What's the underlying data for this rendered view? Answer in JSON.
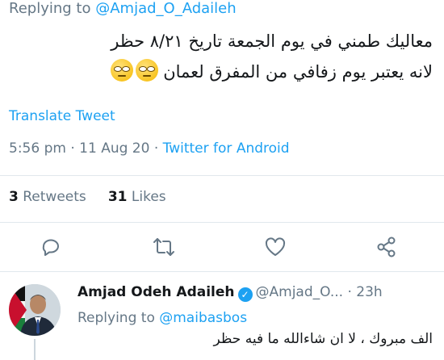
{
  "reply_to": {
    "prefix": "Replying to",
    "handle": "@Amjad_O_Adaileh"
  },
  "tweet": {
    "line1": "معاليك طمني في يوم الجمعة تاريخ ٨/٢١ حظر",
    "line2": "لانه يعتبر يوم زفافي من المفرق لعمان",
    "emojis": [
      "face-with-rolling-eyes-emoji",
      "face-with-rolling-eyes-emoji"
    ]
  },
  "translate_label": "Translate Tweet",
  "meta": {
    "time": "5:56 pm",
    "sep1": " · ",
    "date": "11 Aug 20",
    "sep2": " · ",
    "source": "Twitter for Android"
  },
  "stats": {
    "retweets_count": "3",
    "retweets_label": "Retweets",
    "likes_count": "31",
    "likes_label": "Likes"
  },
  "actions": [
    "reply-icon",
    "retweet-icon",
    "like-icon",
    "share-icon"
  ],
  "reply": {
    "name": "Amjad Odeh Adaileh",
    "handle": "@Amjad_O...",
    "sep": " · ",
    "time": "23h",
    "replying_prefix": "Replying to",
    "replying_handle": "@maibasbos",
    "text": "الف مبروك ، لا ان شاءالله ما فيه حظر"
  },
  "colors": {
    "accent": "#1da1f2",
    "muted": "#657786",
    "text": "#14171a",
    "divider": "#e1e8ed"
  }
}
